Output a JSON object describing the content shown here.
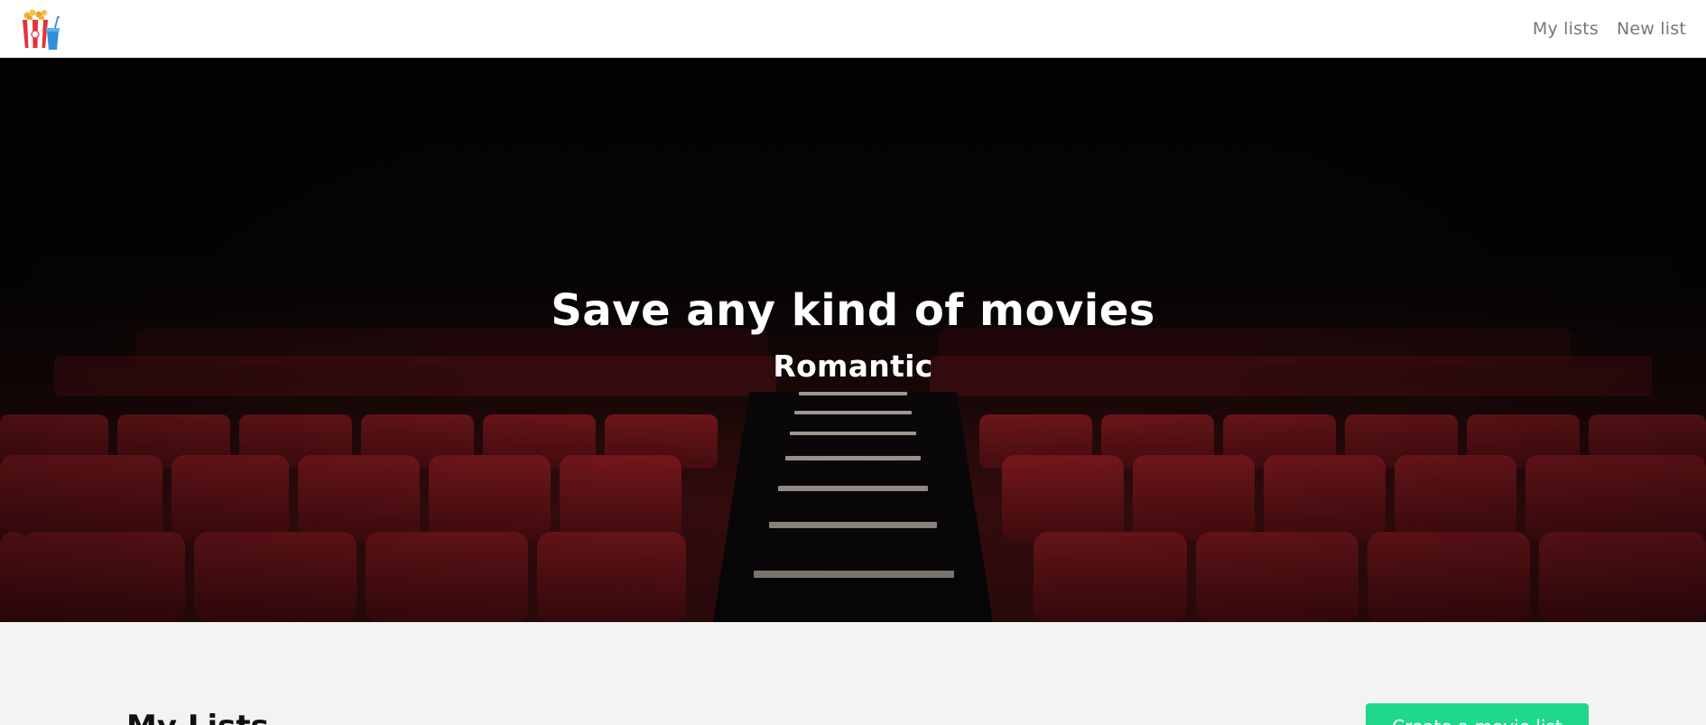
{
  "navbar": {
    "logo_icon": "popcorn-drink-icon",
    "links": [
      {
        "label": "My lists"
      },
      {
        "label": "New list"
      }
    ]
  },
  "hero": {
    "title": "Save any kind of movies",
    "subtitle": "Romantic"
  },
  "main": {
    "section_title": "My Lists",
    "create_button_label": "Create a movie list"
  },
  "colors": {
    "accent": "#1fd88a",
    "seat_red": "#6b1418",
    "navbar_bg": "#ffffff",
    "content_bg": "#f3f3f3"
  }
}
